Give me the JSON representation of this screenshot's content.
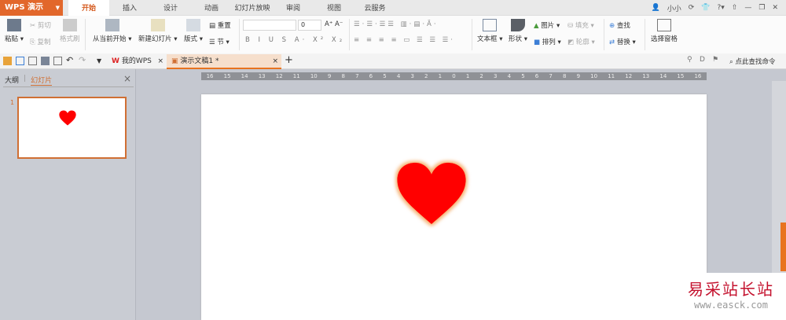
{
  "app": {
    "title": "WPS 演示",
    "accent": "#e2672b"
  },
  "tabs": [
    "开始",
    "插入",
    "设计",
    "动画",
    "幻灯片放映",
    "审阅",
    "视图",
    "云服务"
  ],
  "user": {
    "name": "小小"
  },
  "ribbon": {
    "paste": "粘贴",
    "cut": "剪切",
    "copy": "复制",
    "format_painter": "格式刷",
    "from_current": "从当前开始",
    "new_slide": "新建幻灯片",
    "layout": "版式",
    "reset": "重置",
    "section": "节",
    "font_size": "0",
    "textbox": "文本框",
    "shape": "形状",
    "picture": "图片",
    "fill": "填充",
    "arrange": "排列",
    "outline": "轮廓",
    "find": "查找",
    "replace": "替换",
    "selection_pane": "选择窗格"
  },
  "doc_tabs": [
    {
      "label": "我的WPS"
    },
    {
      "label": "演示文稿1 *"
    }
  ],
  "search_command": "点此查找命令",
  "panel": {
    "outline_tab": "大纲",
    "slides_tab": "幻灯片",
    "slide_number": "1"
  },
  "ruler": [
    "16",
    "15",
    "14",
    "13",
    "12",
    "11",
    "10",
    "9",
    "8",
    "7",
    "6",
    "5",
    "4",
    "3",
    "2",
    "1",
    "0",
    "1",
    "2",
    "3",
    "4",
    "5",
    "6",
    "7",
    "8",
    "9",
    "10",
    "11",
    "12",
    "13",
    "14",
    "15",
    "16"
  ],
  "watermark": {
    "line1": "易采站长站",
    "line2": "www.easck.com"
  },
  "heart_color": "#ff0000"
}
